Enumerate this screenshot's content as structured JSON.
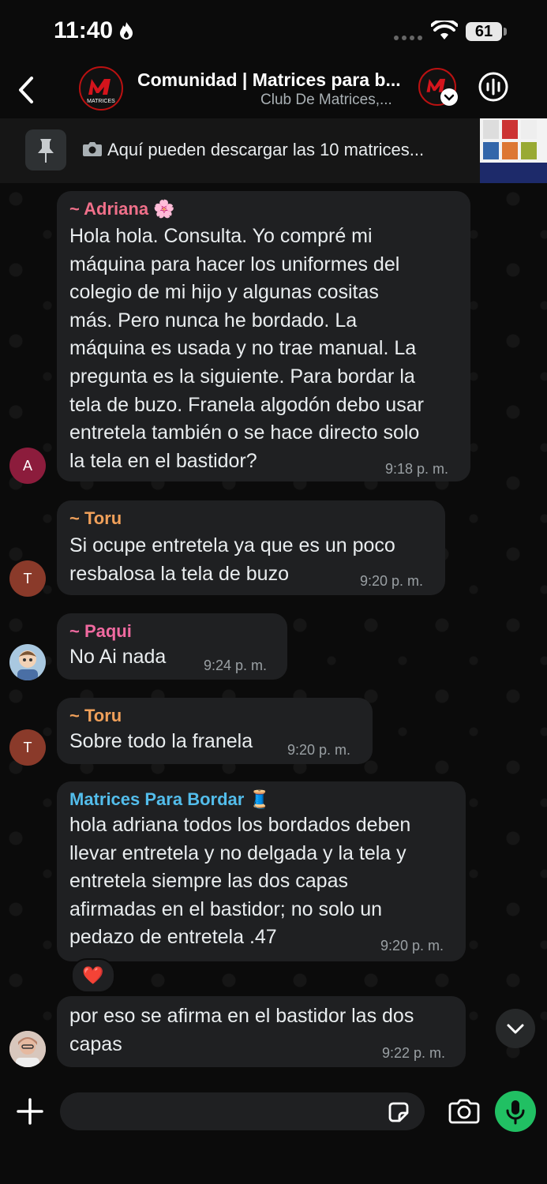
{
  "status_bar": {
    "time": "11:40",
    "battery": "61"
  },
  "header": {
    "title": "Comunidad | Matrices para b...",
    "subtitle": "Club De Matrices,...",
    "logo_text": "MATRICES"
  },
  "pinned": {
    "text": "Aquí pueden descargar las 10 matrices..."
  },
  "messages": [
    {
      "sender": "~ Adriana 🌸",
      "sender_color": "#f0708a",
      "lines": [
        "Hola hola. Consulta. Yo compré mi",
        "máquina para hacer los uniformes del",
        "colegio de mi hijo y algunas cositas",
        "más. Pero nunca he bordado. La",
        "máquina es usada y no trae manual. La",
        "pregunta es la siguiente. Para bordar la",
        "tela de buzo. Franela algodón debo usar",
        "entretela también o se hace directo solo",
        "la tela en el bastidor?"
      ],
      "time": "9:18 p. m.",
      "avatar": "A",
      "avatar_color": "#8c1c3c"
    },
    {
      "sender": "~ Toru",
      "sender_color": "#f0a05a",
      "lines": [
        "Si ocupe entretela ya que es un poco",
        "resbalosa la tela de buzo"
      ],
      "time": "9:20 p. m.",
      "avatar": "T",
      "avatar_color": "#8a3a2a"
    },
    {
      "sender": "~ Paqui",
      "sender_color": "#f06aa0",
      "lines": [
        "No Ai nada"
      ],
      "time": "9:24 p. m."
    },
    {
      "sender": "~ Toru",
      "sender_color": "#f0a05a",
      "lines": [
        "Sobre todo la franela"
      ],
      "time": "9:20 p. m.",
      "avatar": "T",
      "avatar_color": "#8a3a2a"
    },
    {
      "sender": "Matrices Para Bordar 🧵",
      "sender_color": "#53bdeb",
      "lines": [
        "hola adriana todos los bordados deben",
        "llevar entretela y no delgada y la tela y",
        "entretela siempre las dos capas",
        "afirmadas en el bastidor; no solo un",
        "pedazo de entretela .47"
      ],
      "time": "9:20 p. m.",
      "reaction": "❤️"
    },
    {
      "lines": [
        "por eso se afirma en el bastidor las dos",
        "capas"
      ],
      "time": "9:22 p. m."
    }
  ],
  "colors": {
    "accent_green": "#21c063",
    "bubble": "#1f2022",
    "background": "#0b0b0b"
  }
}
